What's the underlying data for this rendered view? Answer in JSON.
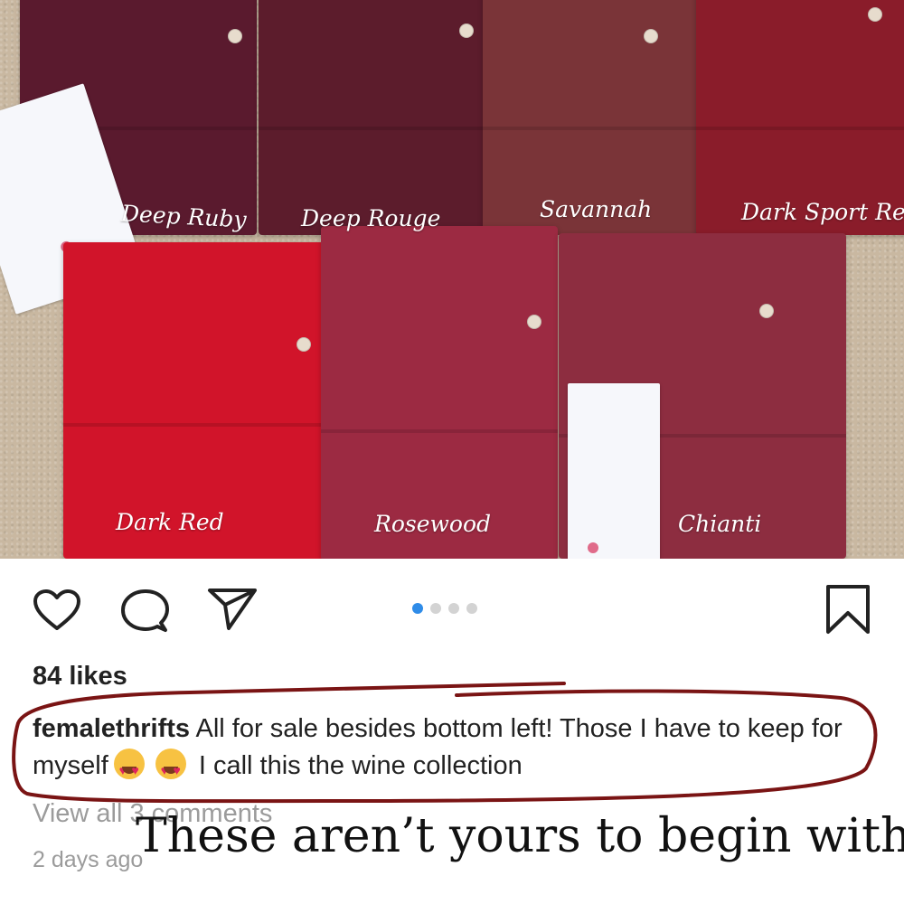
{
  "photo": {
    "swatches": [
      {
        "label": "Deep Ruby",
        "color": "#5a1a2e"
      },
      {
        "label": "Deep Rouge",
        "color": "#5c1c2c"
      },
      {
        "label": "Savannah",
        "color": "#7a3438"
      },
      {
        "label": "Dark Sport Red",
        "color": "#8a1c2a"
      },
      {
        "label": "Dark Red",
        "color": "#d1142a"
      },
      {
        "label": "Rosewood",
        "color": "#9c2a42"
      },
      {
        "label": "Chianti",
        "color": "#8d2d40"
      }
    ]
  },
  "actions": {
    "like_icon": "heart-icon",
    "comment_icon": "comment-icon",
    "share_icon": "send-icon",
    "save_icon": "bookmark-icon",
    "carousel_active_index": 0,
    "carousel_count": 4
  },
  "post": {
    "likes": "84 likes",
    "username": "femalethrifts",
    "caption_part1": "All for sale besides bottom left! Those I have to keep for myself",
    "caption_part2": "I call this the wine collection",
    "emoji": "heart-eyes-emoji",
    "view_comments": "View all 3 comments",
    "timestamp": "2 days ago"
  },
  "overlay": {
    "text": "These aren’t yours to begin with!",
    "annotation_color": "#7a1414"
  }
}
